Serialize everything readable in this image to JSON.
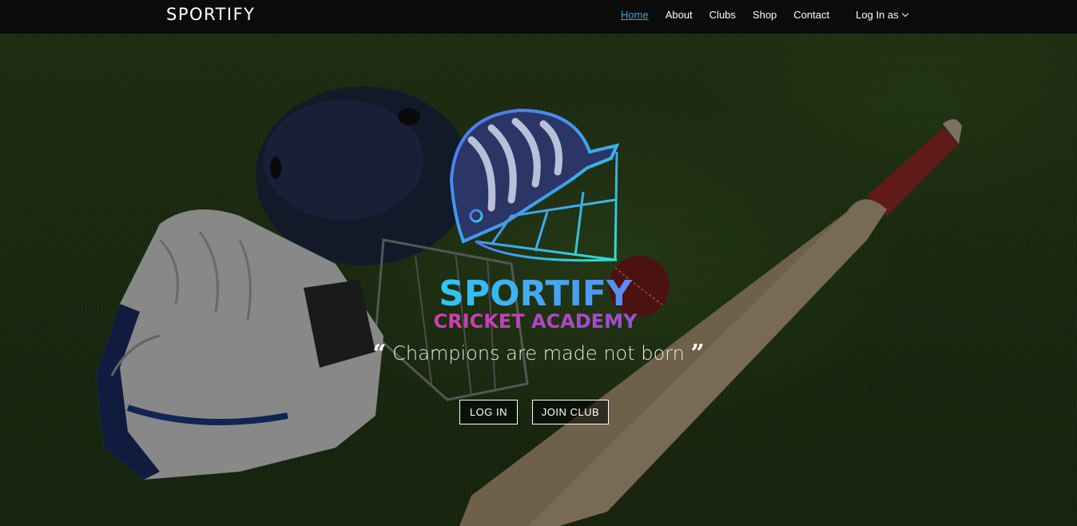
{
  "navbar": {
    "brand": "SPORTIFY",
    "links": [
      {
        "label": "Home",
        "active": true
      },
      {
        "label": "About"
      },
      {
        "label": "Clubs"
      },
      {
        "label": "Shop"
      },
      {
        "label": "Contact"
      }
    ],
    "login_dropdown": "Log In as",
    "active_color": "#30a6e6"
  },
  "hero": {
    "logo": {
      "title": "SPORTIFY",
      "subtitle": "CRICKET ACADEMY",
      "icon": "cricket-helmet-icon"
    },
    "tagline": "Champions are made not born",
    "buttons": {
      "login": "LOG IN",
      "join": "JOIN CLUB"
    }
  },
  "background": {
    "description_icons": [
      "cricket-helmet",
      "batting-gloves",
      "cricket-bat",
      "cricket-ball",
      "grass"
    ]
  }
}
